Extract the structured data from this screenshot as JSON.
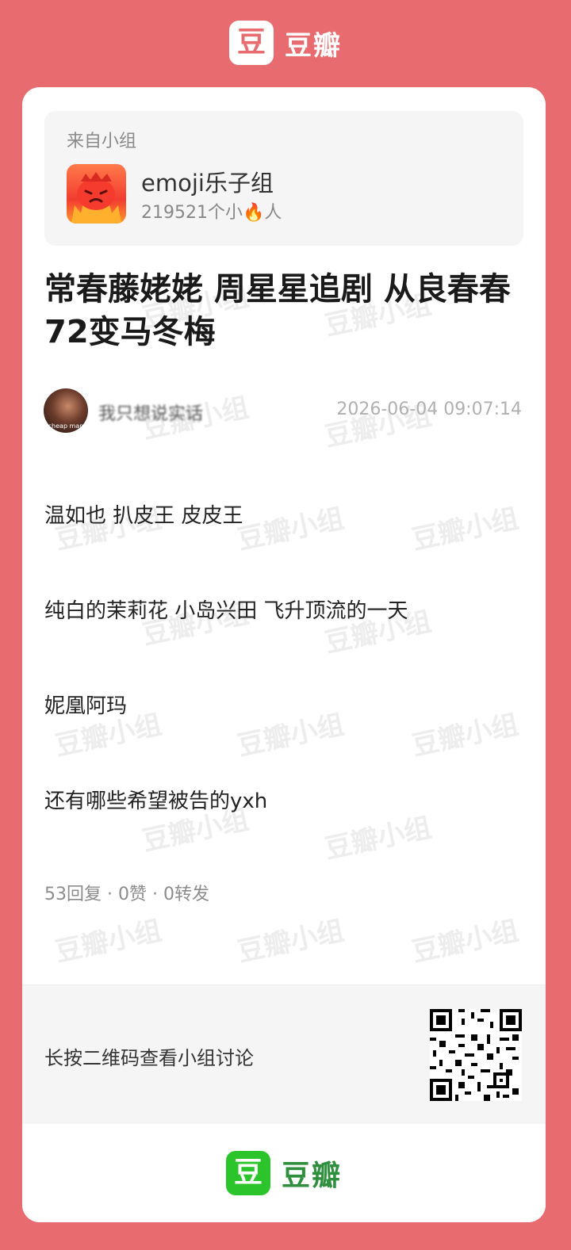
{
  "header": {
    "logo_char": "豆",
    "brand_name": "豆瓣"
  },
  "watermark_text": "豆瓣小组",
  "group": {
    "from_label": "来自小组",
    "avatar_icon": "fire-monster-icon",
    "name": "emoji乐子组",
    "members": "219521个小🔥人"
  },
  "post": {
    "title": "常春藤姥姥 周星星追剧 从良春春 72变马冬梅",
    "author_name": "我只想说实话",
    "avatar_caption": "cheap man",
    "time": "2026-06-04 09:07:14",
    "paragraphs": [
      "温如也 扒皮王 皮皮王",
      "纯白的茉莉花 小岛兴田 飞升顶流的一天",
      "妮凰阿玛",
      "还有哪些希望被告的yxh"
    ],
    "stats": "53回复 · 0赞 · 0转发"
  },
  "qr": {
    "prompt": "长按二维码查看小组讨论"
  },
  "footer": {
    "logo_char": "豆",
    "brand_name": "豆瓣"
  },
  "colors": {
    "background": "#e76b6f",
    "card": "#ffffff",
    "douban_green": "#2bc52b"
  }
}
